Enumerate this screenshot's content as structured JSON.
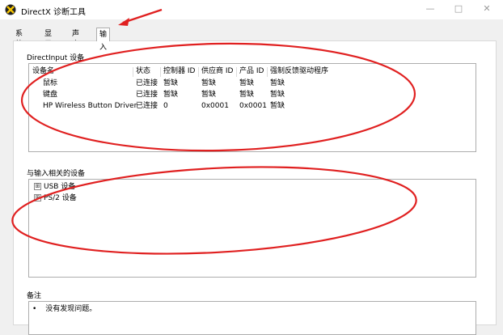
{
  "window": {
    "title": "DirectX 诊断工具",
    "minimize_glyph": "—",
    "maximize_glyph": "□",
    "close_glyph": "✕"
  },
  "tabs": [
    {
      "label": "系统"
    },
    {
      "label": "显示"
    },
    {
      "label": "声音"
    },
    {
      "label": "输入"
    }
  ],
  "directinput": {
    "group_label": "DirectInput 设备",
    "columns": [
      "设备名",
      "状态",
      "控制器 ID",
      "供应商 ID",
      "产品 ID",
      "强制反馈驱动程序"
    ],
    "rows": [
      [
        "鼠标",
        "已连接",
        "暂缺",
        "暂缺",
        "暂缺",
        "暂缺"
      ],
      [
        "键盘",
        "已连接",
        "暂缺",
        "暂缺",
        "暂缺",
        "暂缺"
      ],
      [
        "HP Wireless Button Driver",
        "已连接",
        "0",
        "0x0001",
        "0x0001",
        "暂缺"
      ]
    ]
  },
  "related": {
    "group_label": "与输入相关的设备",
    "items": [
      {
        "expander": "⊞",
        "label": "USB 设备"
      },
      {
        "expander": "⊞",
        "label": "PS/2 设备"
      }
    ]
  },
  "notes": {
    "group_label": "备注",
    "bullet": "•",
    "text": "没有发现问题。"
  },
  "colors": {
    "annotation_red": "#e02020",
    "window_bg": "#f0f0f0"
  }
}
